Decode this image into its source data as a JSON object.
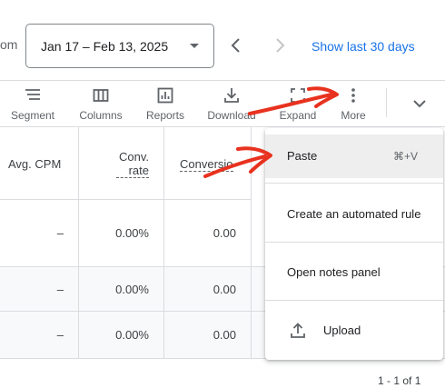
{
  "topbar": {
    "truncated_text": "om",
    "date_range": "Jan 17 – Feb 13, 2025",
    "show_last": "Show last 30 days"
  },
  "toolbar": {
    "items": [
      {
        "label": "Segment",
        "icon": "segment-icon"
      },
      {
        "label": "Columns",
        "icon": "columns-icon"
      },
      {
        "label": "Reports",
        "icon": "reports-icon"
      },
      {
        "label": "Download",
        "icon": "download-icon"
      },
      {
        "label": "Expand",
        "icon": "expand-icon"
      },
      {
        "label": "More",
        "icon": "more-vert-icon"
      }
    ]
  },
  "table": {
    "headers": [
      "Avg. CPM",
      "Conv. rate",
      "Conversio"
    ],
    "rows": [
      {
        "avg_cpm": "–",
        "conv_rate": "0.00%",
        "conversions": "0.00"
      },
      {
        "avg_cpm": "–",
        "conv_rate": "0.00%",
        "conversions": "0.00"
      },
      {
        "avg_cpm": "–",
        "conv_rate": "0.00%",
        "conversions": "0.00"
      }
    ],
    "pagination": "1 - 1 of 1"
  },
  "menu": {
    "paste": {
      "label": "Paste",
      "shortcut": "⌘+V"
    },
    "create_rule": "Create an automated rule",
    "notes": "Open notes panel",
    "upload": {
      "label": "Upload",
      "icon": "upload-icon"
    }
  },
  "colors": {
    "accent": "#1a73e8",
    "annotation": "#e8321f",
    "divider": "#dadce0",
    "highlight": "#eeeeee"
  }
}
